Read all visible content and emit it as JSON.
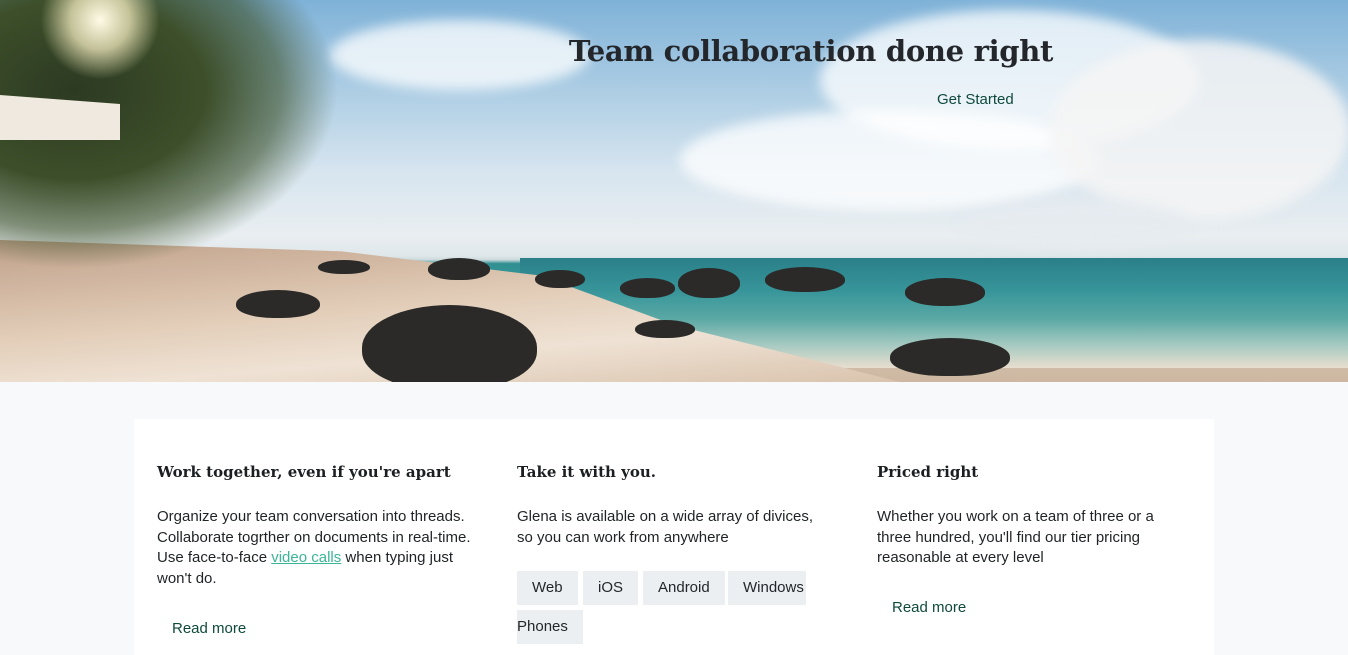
{
  "hero": {
    "title": "Team collaboration done right",
    "cta_label": "Get Started"
  },
  "features": [
    {
      "title": "Work together, even if you're apart",
      "text_before_link": "Organize your team conversation into threads. Collaborate togrther on documents in real-time. Use face-to-face ",
      "link_label": "video calls",
      "text_after_link": " when typing just won't do.",
      "read_more": "Read more"
    },
    {
      "title": "Take it with you.",
      "text": "Glena is available on a wide array of divices, so you can work from anywhere",
      "platforms": [
        "Web",
        "iOS",
        "Android",
        "Windows",
        "Phones"
      ]
    },
    {
      "title": "Priced right",
      "text": "Whether you work on a team of three or a three hundred, you'll find our tier pricing reasonable at every level",
      "read_more": "Read more"
    }
  ],
  "colors": {
    "accent_dark_green": "#0e4a3b",
    "link_green": "#3bb598",
    "chip_bg": "#eceff1",
    "page_bg": "#f7f9fa"
  }
}
